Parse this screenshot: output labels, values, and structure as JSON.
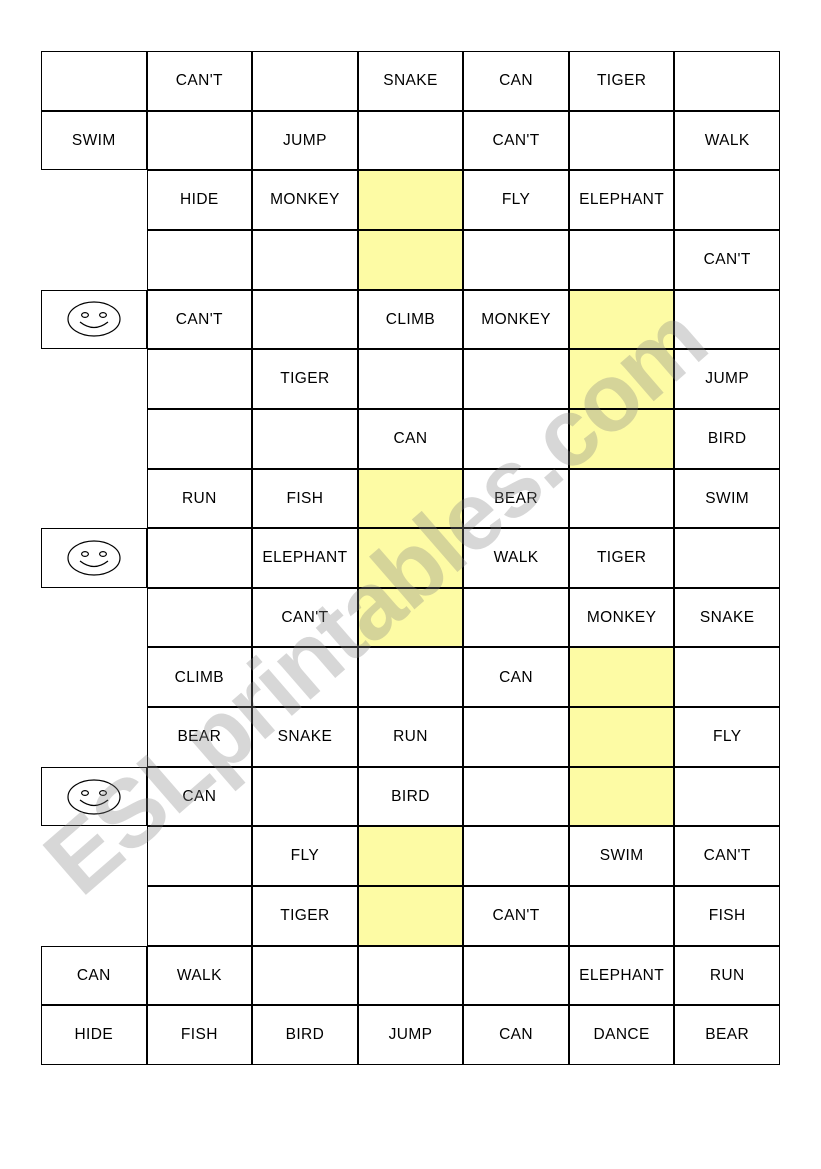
{
  "document": {
    "type": "esl-worksheet-grid",
    "watermark_text": "ESLprintables.com",
    "highlight_color": "#FDFBA4",
    "grid": {
      "rows": 17,
      "columns": 7
    }
  },
  "icons": {
    "smiley": "smiley-face-icon"
  },
  "grid_rows": [
    {
      "row": 1,
      "cells": [
        {
          "col": 1,
          "text": "",
          "bordered": true,
          "icon": null
        },
        {
          "col": 2,
          "text": "CAN'T",
          "bordered": true,
          "icon": null
        },
        {
          "col": 3,
          "text": "",
          "bordered": true,
          "icon": null
        },
        {
          "col": 4,
          "text": "SNAKE",
          "bordered": true,
          "icon": null
        },
        {
          "col": 5,
          "text": "CAN",
          "bordered": true,
          "icon": null
        },
        {
          "col": 6,
          "text": "TIGER",
          "bordered": true,
          "icon": null
        },
        {
          "col": 7,
          "text": "",
          "bordered": true,
          "icon": null
        }
      ]
    },
    {
      "row": 2,
      "cells": [
        {
          "col": 1,
          "text": "SWIM",
          "bordered": true,
          "icon": null
        },
        {
          "col": 2,
          "text": "",
          "bordered": true,
          "icon": null
        },
        {
          "col": 3,
          "text": "JUMP",
          "bordered": true,
          "icon": null
        },
        {
          "col": 4,
          "text": "",
          "bordered": true,
          "icon": null
        },
        {
          "col": 5,
          "text": "CAN'T",
          "bordered": true,
          "icon": null
        },
        {
          "col": 6,
          "text": "",
          "bordered": true,
          "icon": null
        },
        {
          "col": 7,
          "text": "WALK",
          "bordered": true,
          "icon": null
        }
      ]
    },
    {
      "row": 3,
      "cells": [
        {
          "col": 1,
          "text": "",
          "bordered": false,
          "icon": null
        },
        {
          "col": 2,
          "text": "HIDE",
          "bordered": true,
          "icon": null
        },
        {
          "col": 3,
          "text": "MONKEY",
          "bordered": true,
          "icon": null
        },
        {
          "col": 4,
          "text": "",
          "bordered": true,
          "icon": null
        },
        {
          "col": 5,
          "text": "FLY",
          "bordered": true,
          "icon": null
        },
        {
          "col": 6,
          "text": "ELEPHANT",
          "bordered": true,
          "icon": null
        },
        {
          "col": 7,
          "text": "",
          "bordered": true,
          "icon": null
        }
      ]
    },
    {
      "row": 4,
      "cells": [
        {
          "col": 1,
          "text": "",
          "bordered": false,
          "icon": null
        },
        {
          "col": 2,
          "text": "",
          "bordered": true,
          "icon": null
        },
        {
          "col": 3,
          "text": "",
          "bordered": true,
          "icon": null
        },
        {
          "col": 4,
          "text": "",
          "bordered": true,
          "icon": null
        },
        {
          "col": 5,
          "text": "",
          "bordered": true,
          "icon": null
        },
        {
          "col": 6,
          "text": "",
          "bordered": true,
          "icon": null
        },
        {
          "col": 7,
          "text": "CAN'T",
          "bordered": true,
          "icon": null
        }
      ]
    },
    {
      "row": 5,
      "cells": [
        {
          "col": 1,
          "text": "",
          "bordered": true,
          "icon": "smiley"
        },
        {
          "col": 2,
          "text": "CAN'T",
          "bordered": true,
          "icon": null
        },
        {
          "col": 3,
          "text": "",
          "bordered": true,
          "icon": null
        },
        {
          "col": 4,
          "text": "CLIMB",
          "bordered": true,
          "icon": null
        },
        {
          "col": 5,
          "text": "MONKEY",
          "bordered": true,
          "icon": null
        },
        {
          "col": 6,
          "text": "",
          "bordered": true,
          "icon": null
        },
        {
          "col": 7,
          "text": "",
          "bordered": true,
          "icon": null
        }
      ]
    },
    {
      "row": 6,
      "cells": [
        {
          "col": 1,
          "text": "",
          "bordered": false,
          "icon": null
        },
        {
          "col": 2,
          "text": "",
          "bordered": true,
          "icon": null
        },
        {
          "col": 3,
          "text": "TIGER",
          "bordered": true,
          "icon": null
        },
        {
          "col": 4,
          "text": "",
          "bordered": true,
          "icon": null
        },
        {
          "col": 5,
          "text": "",
          "bordered": true,
          "icon": null
        },
        {
          "col": 6,
          "text": "",
          "bordered": true,
          "icon": null
        },
        {
          "col": 7,
          "text": "JUMP",
          "bordered": true,
          "icon": null
        }
      ]
    },
    {
      "row": 7,
      "cells": [
        {
          "col": 1,
          "text": "",
          "bordered": false,
          "icon": null
        },
        {
          "col": 2,
          "text": "",
          "bordered": true,
          "icon": null
        },
        {
          "col": 3,
          "text": "",
          "bordered": true,
          "icon": null
        },
        {
          "col": 4,
          "text": "CAN",
          "bordered": true,
          "icon": null
        },
        {
          "col": 5,
          "text": "",
          "bordered": true,
          "icon": null
        },
        {
          "col": 6,
          "text": "",
          "bordered": true,
          "icon": null
        },
        {
          "col": 7,
          "text": "BIRD",
          "bordered": true,
          "icon": null
        }
      ]
    },
    {
      "row": 8,
      "cells": [
        {
          "col": 1,
          "text": "",
          "bordered": false,
          "icon": null
        },
        {
          "col": 2,
          "text": "RUN",
          "bordered": true,
          "icon": null
        },
        {
          "col": 3,
          "text": "FISH",
          "bordered": true,
          "icon": null
        },
        {
          "col": 4,
          "text": "",
          "bordered": true,
          "icon": null
        },
        {
          "col": 5,
          "text": "BEAR",
          "bordered": true,
          "icon": null
        },
        {
          "col": 6,
          "text": "",
          "bordered": true,
          "icon": null
        },
        {
          "col": 7,
          "text": "SWIM",
          "bordered": true,
          "icon": null
        }
      ]
    },
    {
      "row": 9,
      "cells": [
        {
          "col": 1,
          "text": "",
          "bordered": true,
          "icon": "smiley"
        },
        {
          "col": 2,
          "text": "",
          "bordered": true,
          "icon": null
        },
        {
          "col": 3,
          "text": "ELEPHANT",
          "bordered": true,
          "icon": null
        },
        {
          "col": 4,
          "text": "",
          "bordered": true,
          "icon": null
        },
        {
          "col": 5,
          "text": "WALK",
          "bordered": true,
          "icon": null
        },
        {
          "col": 6,
          "text": "TIGER",
          "bordered": true,
          "icon": null
        },
        {
          "col": 7,
          "text": "",
          "bordered": true,
          "icon": null
        }
      ]
    },
    {
      "row": 10,
      "cells": [
        {
          "col": 1,
          "text": "",
          "bordered": false,
          "icon": null
        },
        {
          "col": 2,
          "text": "",
          "bordered": true,
          "icon": null
        },
        {
          "col": 3,
          "text": "CAN'T",
          "bordered": true,
          "icon": null
        },
        {
          "col": 4,
          "text": "",
          "bordered": true,
          "icon": null
        },
        {
          "col": 5,
          "text": "",
          "bordered": true,
          "icon": null
        },
        {
          "col": 6,
          "text": "MONKEY",
          "bordered": true,
          "icon": null
        },
        {
          "col": 7,
          "text": "SNAKE",
          "bordered": true,
          "icon": null
        }
      ]
    },
    {
      "row": 11,
      "cells": [
        {
          "col": 1,
          "text": "",
          "bordered": false,
          "icon": null
        },
        {
          "col": 2,
          "text": "CLIMB",
          "bordered": true,
          "icon": null
        },
        {
          "col": 3,
          "text": "",
          "bordered": true,
          "icon": null
        },
        {
          "col": 4,
          "text": "",
          "bordered": true,
          "icon": null
        },
        {
          "col": 5,
          "text": "CAN",
          "bordered": true,
          "icon": null
        },
        {
          "col": 6,
          "text": "",
          "bordered": true,
          "icon": null
        },
        {
          "col": 7,
          "text": "",
          "bordered": true,
          "icon": null
        }
      ]
    },
    {
      "row": 12,
      "cells": [
        {
          "col": 1,
          "text": "",
          "bordered": false,
          "icon": null
        },
        {
          "col": 2,
          "text": "BEAR",
          "bordered": true,
          "icon": null
        },
        {
          "col": 3,
          "text": "SNAKE",
          "bordered": true,
          "icon": null
        },
        {
          "col": 4,
          "text": "RUN",
          "bordered": true,
          "icon": null
        },
        {
          "col": 5,
          "text": "",
          "bordered": true,
          "icon": null
        },
        {
          "col": 6,
          "text": "",
          "bordered": true,
          "icon": null
        },
        {
          "col": 7,
          "text": "FLY",
          "bordered": true,
          "icon": null
        }
      ]
    },
    {
      "row": 13,
      "cells": [
        {
          "col": 1,
          "text": "",
          "bordered": true,
          "icon": "smiley"
        },
        {
          "col": 2,
          "text": "CAN",
          "bordered": true,
          "icon": null
        },
        {
          "col": 3,
          "text": "",
          "bordered": true,
          "icon": null
        },
        {
          "col": 4,
          "text": "BIRD",
          "bordered": true,
          "icon": null
        },
        {
          "col": 5,
          "text": "",
          "bordered": true,
          "icon": null
        },
        {
          "col": 6,
          "text": "",
          "bordered": true,
          "icon": null
        },
        {
          "col": 7,
          "text": "",
          "bordered": true,
          "icon": null
        }
      ]
    },
    {
      "row": 14,
      "cells": [
        {
          "col": 1,
          "text": "",
          "bordered": false,
          "icon": null
        },
        {
          "col": 2,
          "text": "",
          "bordered": true,
          "icon": null
        },
        {
          "col": 3,
          "text": "FLY",
          "bordered": true,
          "icon": null
        },
        {
          "col": 4,
          "text": "",
          "bordered": true,
          "icon": null
        },
        {
          "col": 5,
          "text": "",
          "bordered": true,
          "icon": null
        },
        {
          "col": 6,
          "text": "SWIM",
          "bordered": true,
          "icon": null
        },
        {
          "col": 7,
          "text": "CAN'T",
          "bordered": true,
          "icon": null
        }
      ]
    },
    {
      "row": 15,
      "cells": [
        {
          "col": 1,
          "text": "",
          "bordered": false,
          "icon": null
        },
        {
          "col": 2,
          "text": "",
          "bordered": true,
          "icon": null
        },
        {
          "col": 3,
          "text": "TIGER",
          "bordered": true,
          "icon": null
        },
        {
          "col": 4,
          "text": "",
          "bordered": true,
          "icon": null
        },
        {
          "col": 5,
          "text": "CAN'T",
          "bordered": true,
          "icon": null
        },
        {
          "col": 6,
          "text": "",
          "bordered": true,
          "icon": null
        },
        {
          "col": 7,
          "text": "FISH",
          "bordered": true,
          "icon": null
        }
      ]
    },
    {
      "row": 16,
      "cells": [
        {
          "col": 1,
          "text": "CAN",
          "bordered": true,
          "icon": null
        },
        {
          "col": 2,
          "text": "WALK",
          "bordered": true,
          "icon": null
        },
        {
          "col": 3,
          "text": "",
          "bordered": true,
          "icon": null
        },
        {
          "col": 4,
          "text": "",
          "bordered": true,
          "icon": null
        },
        {
          "col": 5,
          "text": "",
          "bordered": true,
          "icon": null
        },
        {
          "col": 6,
          "text": "ELEPHANT",
          "bordered": true,
          "icon": null
        },
        {
          "col": 7,
          "text": "RUN",
          "bordered": true,
          "icon": null
        }
      ]
    },
    {
      "row": 17,
      "cells": [
        {
          "col": 1,
          "text": "HIDE",
          "bordered": true,
          "icon": null
        },
        {
          "col": 2,
          "text": "FISH",
          "bordered": true,
          "icon": null
        },
        {
          "col": 3,
          "text": "BIRD",
          "bordered": true,
          "icon": null
        },
        {
          "col": 4,
          "text": "JUMP",
          "bordered": true,
          "icon": null
        },
        {
          "col": 5,
          "text": "CAN",
          "bordered": true,
          "icon": null
        },
        {
          "col": 6,
          "text": "DANCE",
          "bordered": true,
          "icon": null
        },
        {
          "col": 7,
          "text": "BEAR",
          "bordered": true,
          "icon": null
        }
      ]
    }
  ],
  "highlights": [
    {
      "col": 4,
      "row_start": 3,
      "row_end": 4
    },
    {
      "col": 6,
      "row_start": 5,
      "row_end": 7
    },
    {
      "col": 4,
      "row_start": 8,
      "row_end": 10
    },
    {
      "col": 6,
      "row_start": 11,
      "row_end": 13
    },
    {
      "col": 4,
      "row_start": 14,
      "row_end": 15
    }
  ]
}
